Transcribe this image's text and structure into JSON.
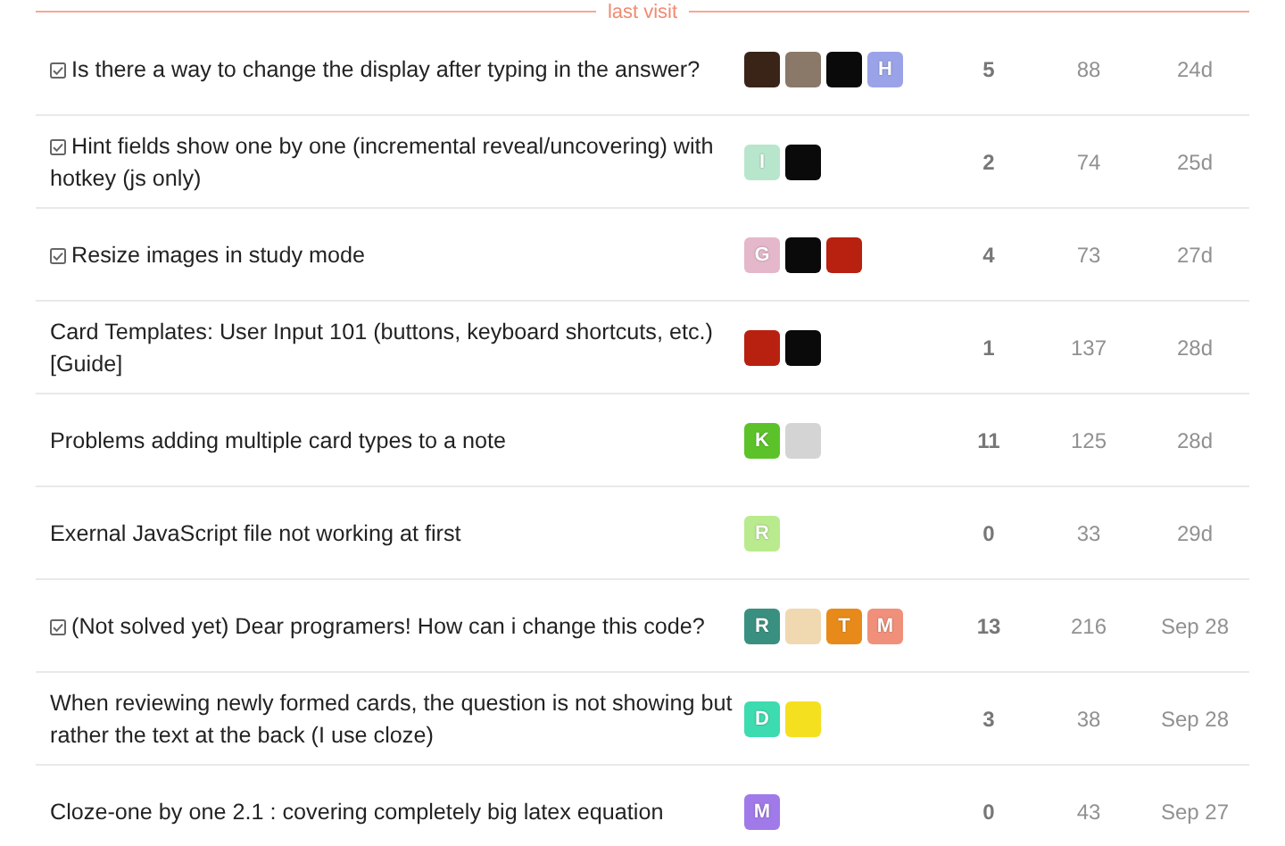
{
  "divider_label": "last visit",
  "topics": [
    {
      "solved": true,
      "title": "Is there a way to change the display after typing in the answer?",
      "posters": [
        {
          "kind": "image",
          "color": "#3a2418"
        },
        {
          "kind": "image",
          "color": "#8a7868"
        },
        {
          "kind": "image",
          "color": "#0a0a0a"
        },
        {
          "kind": "letter",
          "letter": "H",
          "color": "#9aa3e8"
        }
      ],
      "replies": "5",
      "views": "88",
      "activity": "24d"
    },
    {
      "solved": true,
      "title": "Hint fields show one by one (incremental reveal/uncovering) with hotkey (js only)",
      "posters": [
        {
          "kind": "letter",
          "letter": "I",
          "color": "#b8e6cc"
        },
        {
          "kind": "image",
          "color": "#0a0a0a"
        }
      ],
      "replies": "2",
      "views": "74",
      "activity": "25d"
    },
    {
      "solved": true,
      "title": "Resize images in study mode",
      "posters": [
        {
          "kind": "letter",
          "letter": "G",
          "color": "#e5b7cb"
        },
        {
          "kind": "image",
          "color": "#0a0a0a"
        },
        {
          "kind": "image",
          "color": "#b82010"
        }
      ],
      "replies": "4",
      "views": "73",
      "activity": "27d"
    },
    {
      "solved": false,
      "title": "Card Templates: User Input 101 (buttons, keyboard shortcuts, etc.) [Guide]",
      "posters": [
        {
          "kind": "image",
          "color": "#b82010"
        },
        {
          "kind": "image",
          "color": "#0a0a0a"
        }
      ],
      "replies": "1",
      "views": "137",
      "activity": "28d"
    },
    {
      "solved": false,
      "title": "Problems adding multiple card types to a note",
      "posters": [
        {
          "kind": "letter",
          "letter": "K",
          "color": "#5cc22a"
        },
        {
          "kind": "image",
          "color": "#d4d4d4"
        }
      ],
      "replies": "11",
      "views": "125",
      "activity": "28d"
    },
    {
      "solved": false,
      "title": "Exernal JavaScript file not working at first",
      "posters": [
        {
          "kind": "letter",
          "letter": "R",
          "color": "#b9eb8e"
        }
      ],
      "replies": "0",
      "views": "33",
      "activity": "29d"
    },
    {
      "solved": true,
      "title": "(Not solved yet) Dear programers! How can i change this code?",
      "posters": [
        {
          "kind": "letter",
          "letter": "R",
          "color": "#3a9080"
        },
        {
          "kind": "image",
          "color": "#f0d8b0"
        },
        {
          "kind": "letter",
          "letter": "T",
          "color": "#e88a1a"
        },
        {
          "kind": "letter",
          "letter": "M",
          "color": "#f0907a"
        }
      ],
      "replies": "13",
      "views": "216",
      "activity": "Sep 28"
    },
    {
      "solved": false,
      "title": "When reviewing newly formed cards, the question is not showing but rather the text at the back (I use cloze)",
      "posters": [
        {
          "kind": "letter",
          "letter": "D",
          "color": "#3ddbb0"
        },
        {
          "kind": "image",
          "color": "#f5e020"
        }
      ],
      "replies": "3",
      "views": "38",
      "activity": "Sep 28"
    },
    {
      "solved": false,
      "title": "Cloze-one by one 2.1 : covering completely big latex equation",
      "posters": [
        {
          "kind": "letter",
          "letter": "M",
          "color": "#a07ae8"
        }
      ],
      "replies": "0",
      "views": "43",
      "activity": "Sep 27"
    }
  ]
}
